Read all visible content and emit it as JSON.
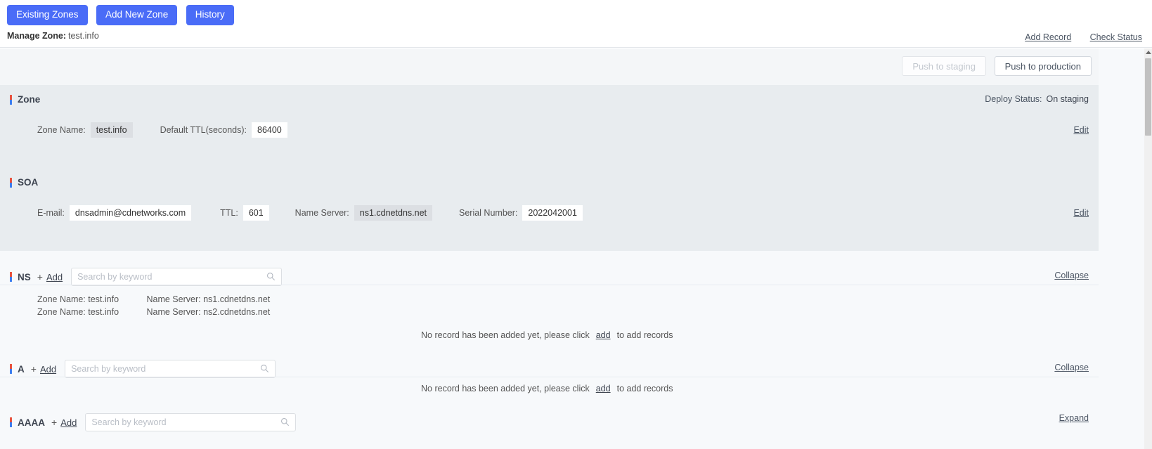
{
  "nav": {
    "buttons": [
      {
        "label": "Existing Zones",
        "name": "existing-zones"
      },
      {
        "label": "Add New Zone",
        "name": "add-new-zone"
      },
      {
        "label": "History",
        "name": "history"
      }
    ],
    "accent_color": "#4a6cf7"
  },
  "header": {
    "manage_label": "Manage Zone:",
    "manage_value": "test.info",
    "add_record": "Add Record",
    "check_status": "Check Status"
  },
  "push": {
    "staging": "Push to staging",
    "production": "Push to production"
  },
  "zone": {
    "title": "Zone",
    "deploy_status_label": "Deploy Status:",
    "deploy_status_value": "On staging",
    "edit": "Edit",
    "zone_name_label": "Zone Name:",
    "zone_name_value": "test.info",
    "ttl_label": "Default TTL(seconds):",
    "ttl_value": "86400"
  },
  "soa": {
    "title": "SOA",
    "edit": "Edit",
    "email_label": "E-mail:",
    "email_value": "dnsadmin@cdnetworks.com",
    "ttl_label": "TTL:",
    "ttl_value": "601",
    "nameserver_label": "Name Server:",
    "nameserver_value": "ns1.cdnetdns.net",
    "serial_label": "Serial Number:",
    "serial_value": "2022042001"
  },
  "records": {
    "search_placeholder": "Search by keyword",
    "add_label": "Add",
    "plus": "+",
    "empty_text_before": "No record has been added yet, please click",
    "empty_link": "add",
    "empty_text_after": "to add records",
    "ns": {
      "type": "NS",
      "toggle": "Collapse",
      "rows": [
        {
          "zone": "Zone Name: test.info",
          "server": "Name Server: ns1.cdnetdns.net"
        },
        {
          "zone": "Zone Name: test.info",
          "server": "Name Server: ns2.cdnetdns.net"
        }
      ]
    },
    "a": {
      "type": "A",
      "toggle": "Collapse"
    },
    "aaaa": {
      "type": "AAAA",
      "toggle": "Expand"
    }
  }
}
